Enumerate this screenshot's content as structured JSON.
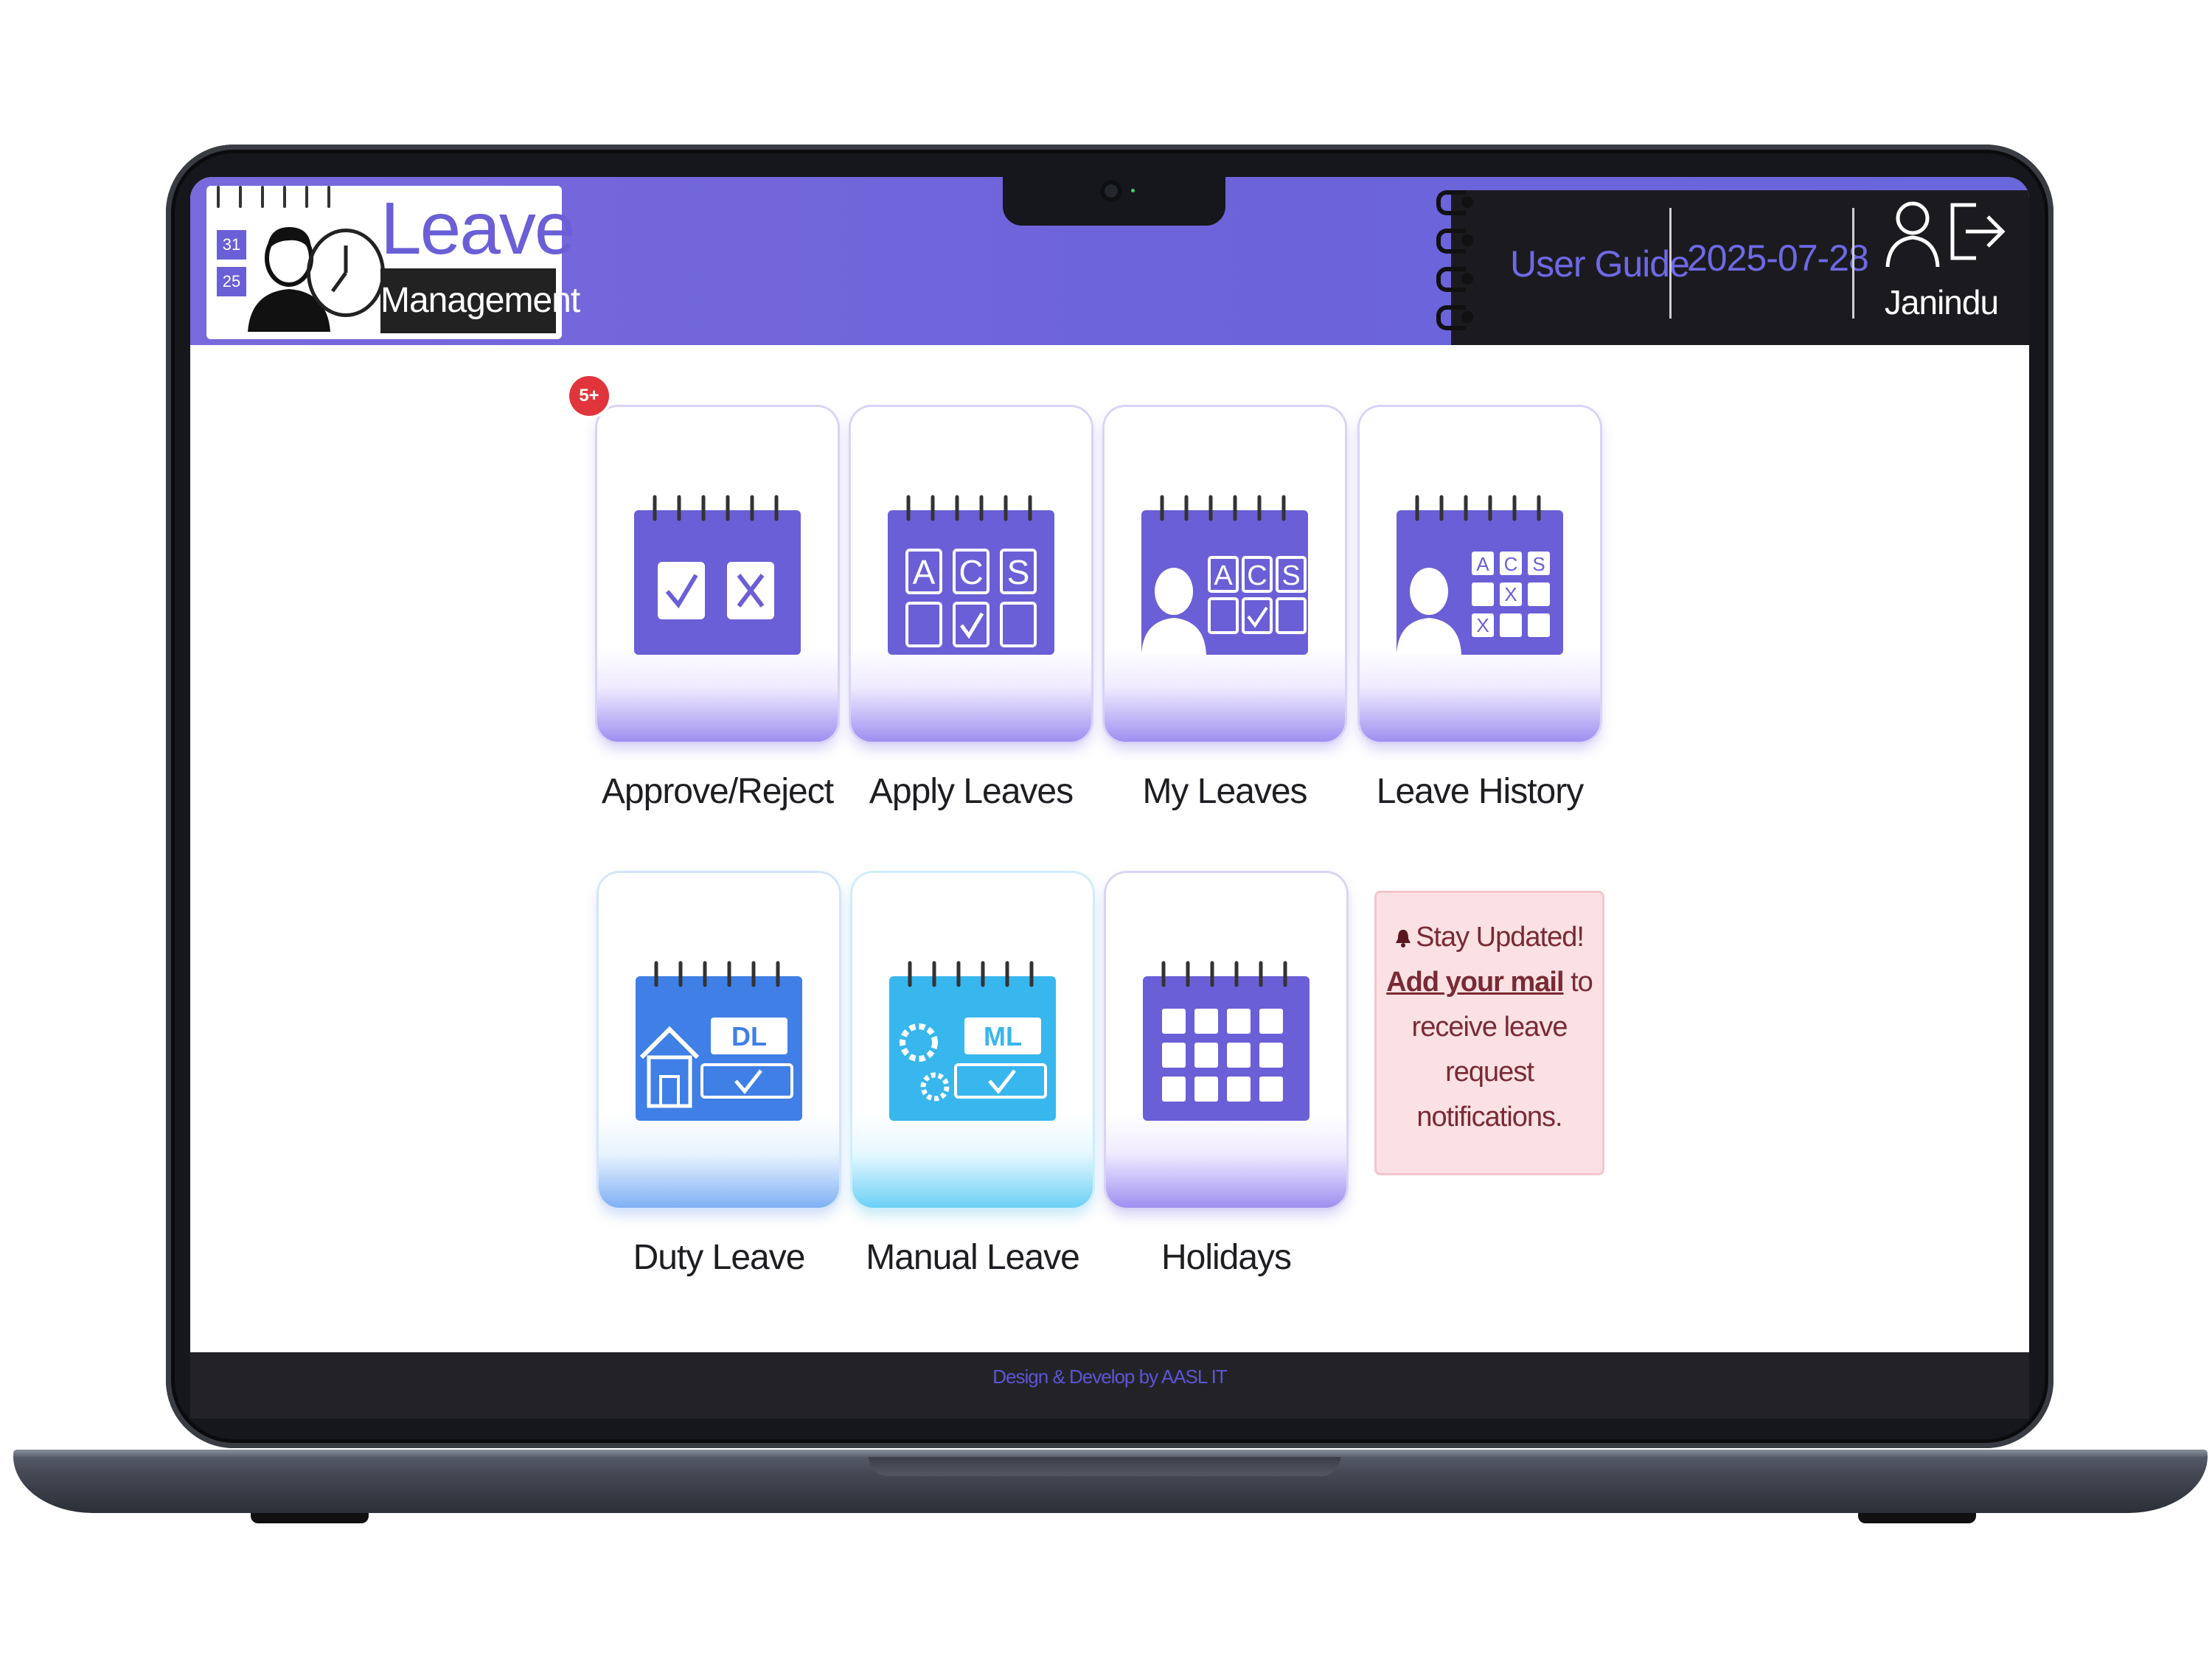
{
  "header": {
    "logo_title": "Leave",
    "logo_subtitle": "Management",
    "logo_dates": [
      "31",
      "25"
    ],
    "user_guide": "User Guide",
    "date": "2025-07-28",
    "username": "Janindu",
    "icons": [
      "user-icon",
      "logout-icon"
    ],
    "background_color": "#6c63d9",
    "accent_color": "#6f68e6"
  },
  "tiles": [
    {
      "label": "Approve/Reject",
      "icon": "approve-reject-icon",
      "badge": "5+"
    },
    {
      "label": "Apply Leaves",
      "icon": "apply-leaves-icon",
      "letters": [
        "A",
        "C",
        "S"
      ]
    },
    {
      "label": "My Leaves",
      "icon": "my-leaves-icon",
      "letters": [
        "A",
        "C",
        "S"
      ]
    },
    {
      "label": "Leave History",
      "icon": "leave-history-icon",
      "letters": [
        "A",
        "C",
        "S",
        "X",
        "X"
      ]
    },
    {
      "label": "Duty Leave",
      "icon": "duty-leave-icon",
      "code": "DL"
    },
    {
      "label": "Manual Leave",
      "icon": "manual-leave-icon",
      "code": "ML"
    },
    {
      "label": "Holidays",
      "icon": "holidays-icon"
    }
  ],
  "notice": {
    "title": "Stay Updated!",
    "link": "Add your mail",
    "text_after_link": "to",
    "line3": "receive leave",
    "line4": "request",
    "line5": "notifications.",
    "background_color": "#fbe1e4"
  },
  "footer": {
    "text": "Design & Develop by AASL IT"
  },
  "colors": {
    "brand_purple": "#6a5fd6",
    "duty_blue": "#3f7fe6",
    "manual_cyan": "#38b6ee",
    "badge_red": "#e0353c"
  }
}
